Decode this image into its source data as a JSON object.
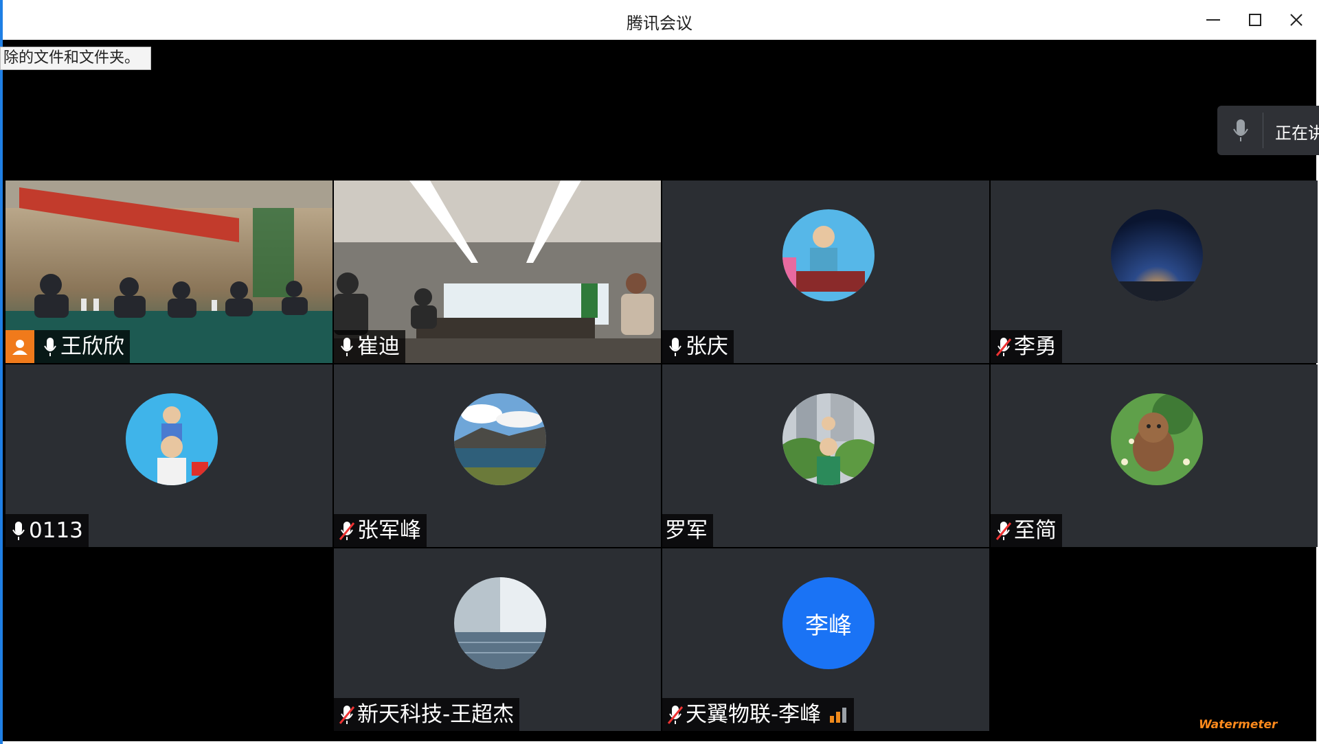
{
  "app": {
    "title": "腾讯会议"
  },
  "tooltip": {
    "text": "除的文件和文件夹。"
  },
  "speaking": {
    "text": "正在讲"
  },
  "tiles": [
    {
      "name": "王欣欣",
      "mic": "on",
      "host": true,
      "kind": "video-meeting-hall"
    },
    {
      "name": "崔迪",
      "mic": "on",
      "kind": "video-conference-room"
    },
    {
      "name": "张庆",
      "mic": "on",
      "kind": "avatar-photo"
    },
    {
      "name": "李勇",
      "mic": "muted",
      "kind": "avatar-photo"
    },
    {
      "name": "0113",
      "mic": "on",
      "kind": "avatar-photo"
    },
    {
      "name": "张军峰",
      "mic": "muted",
      "kind": "avatar-photo"
    },
    {
      "name": "罗军",
      "mic": "none",
      "kind": "avatar-photo"
    },
    {
      "name": "至简",
      "mic": "muted",
      "kind": "avatar-photo"
    },
    {
      "name": "新天科技-王超杰",
      "mic": "muted",
      "kind": "avatar-photo"
    },
    {
      "name": "天翼物联-李峰",
      "mic": "muted",
      "avatar_text": "李峰",
      "avatar_color": "#1a73f5",
      "signal": true
    }
  ],
  "watermark": {
    "text": "Watermeter"
  }
}
